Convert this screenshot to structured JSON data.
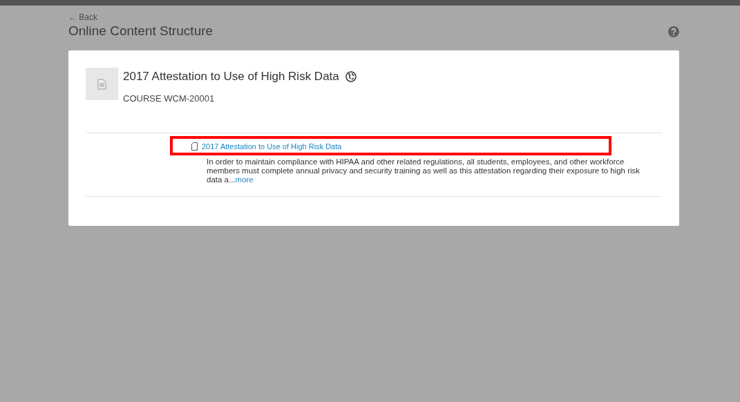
{
  "header": {
    "back": "← Back",
    "title": "Online Content Structure"
  },
  "course": {
    "title": "2017 Attestation to Use of High Risk Data",
    "code": "COURSE WCM-20001"
  },
  "items": [
    {
      "title": "2017 Attestation to Use of High Risk Data",
      "description": "In order to maintain compliance with HIPAA and other related regulations, all students, employees, and other workforce members must complete annual privacy and security training as well as this attestation regarding their exposure to high risk data a...",
      "more": "more",
      "highlighted": true
    }
  ]
}
